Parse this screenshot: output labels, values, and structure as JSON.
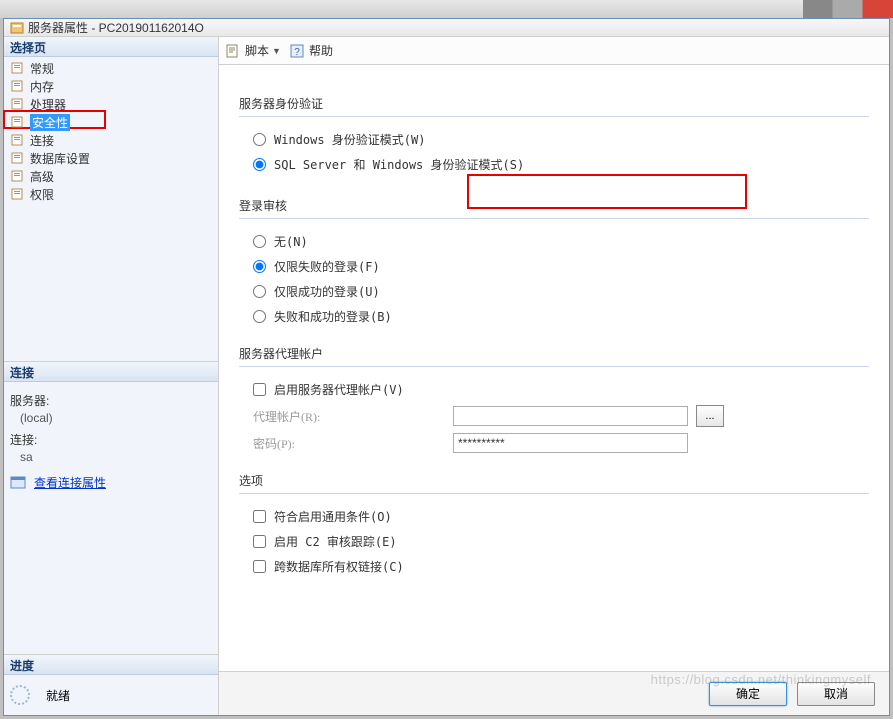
{
  "window": {
    "title": "服务器属性 - PC201901162014O"
  },
  "toolbar": {
    "script_label": "脚本",
    "help_label": "帮助"
  },
  "sidebar": {
    "select_header": "选择页",
    "items": [
      {
        "label": "常规"
      },
      {
        "label": "内存"
      },
      {
        "label": "处理器"
      },
      {
        "label": "安全性"
      },
      {
        "label": "连接"
      },
      {
        "label": "数据库设置"
      },
      {
        "label": "高级"
      },
      {
        "label": "权限"
      }
    ],
    "connection_header": "连接",
    "server_label": "服务器:",
    "server_value": "(local)",
    "conn_label": "连接:",
    "conn_value": "sa",
    "view_link": "查看连接属性",
    "progress_header": "进度",
    "progress_status": "就绪"
  },
  "form": {
    "auth": {
      "title": "服务器身份验证",
      "windows": "Windows 身份验证模式(W)",
      "mixed": "SQL Server 和 Windows 身份验证模式(S)"
    },
    "audit": {
      "title": "登录审核",
      "none": "无(N)",
      "failed": "仅限失败的登录(F)",
      "success": "仅限成功的登录(U)",
      "both": "失败和成功的登录(B)"
    },
    "proxy": {
      "title": "服务器代理帐户",
      "enable": "启用服务器代理帐户(V)",
      "account_label": "代理帐户(R):",
      "password_label": "密码(P):",
      "password_value": "**********",
      "browse": "..."
    },
    "options": {
      "title": "选项",
      "common": "符合启用通用条件(O)",
      "c2": "启用 C2 审核跟踪(E)",
      "chain": "跨数据库所有权链接(C)"
    }
  },
  "buttons": {
    "ok": "确定",
    "cancel": "取消"
  },
  "watermark": "https://blog.csdn.net/thinkingmyself"
}
